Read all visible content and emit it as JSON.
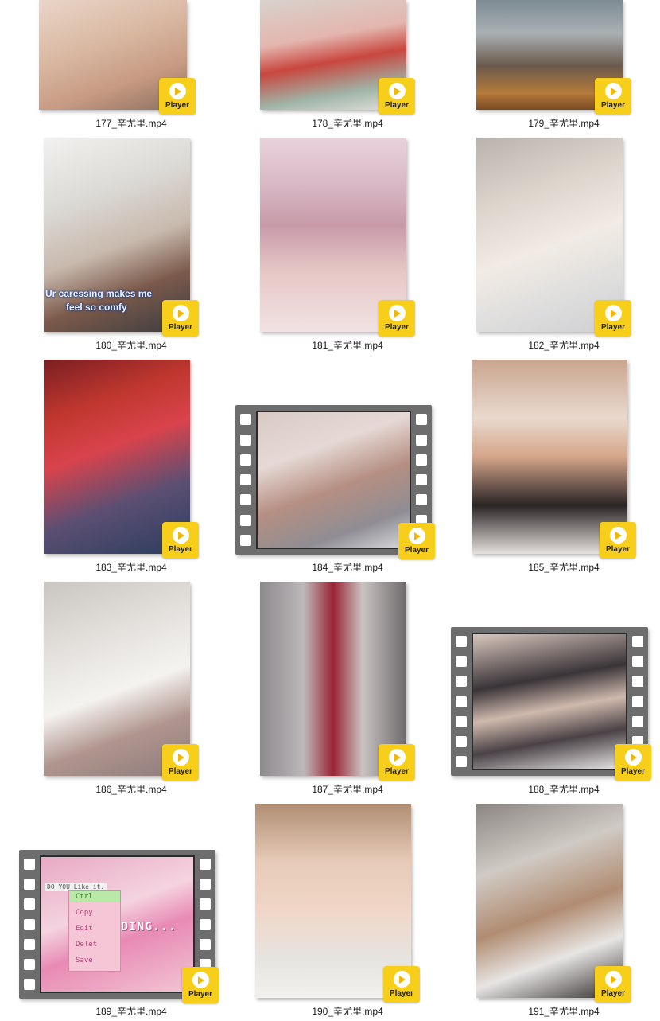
{
  "player_label": "Player",
  "items": [
    {
      "id": "177",
      "file": "177_辛尤里.mp4",
      "kind": "thumb",
      "bg": "linear-gradient(160deg,#e9d5c8 0%,#d9b8a2 40%,#c79a82 70%,#8a6e5e 100%)"
    },
    {
      "id": "178",
      "file": "178_辛尤里.mp4",
      "kind": "thumb",
      "bg": "linear-gradient(170deg,#d8d2cc 0%,#e3b6ae 35%,#c9473f 55%,#9fb5a8 80%,#e7e1da 100%)"
    },
    {
      "id": "179",
      "file": "179_辛尤里.mp4",
      "kind": "thumb",
      "bg": "linear-gradient(180deg,#7d8b93 0%,#a8b0b3 30%,#6b5a4c 60%,#b57a3a 85%,#7a4a22 100%)"
    },
    {
      "id": "180",
      "file": "180_辛尤里.mp4",
      "kind": "thumb",
      "bg": "linear-gradient(160deg,#f1f1ef 0%,#dcdad6 30%,#c8b9ad 55%,#7b5a4b 75%,#3b3b3f 100%)",
      "caption_lines": [
        "Ur caressing makes me",
        "feel so comfy"
      ]
    },
    {
      "id": "181",
      "file": "181_辛尤里.mp4",
      "kind": "thumb",
      "bg": "linear-gradient(180deg,#e9d2dc 0%,#d7b7c4 25%,#c89aa8 45%,#e7c9c6 70%,#f1e1e3 100%)"
    },
    {
      "id": "182",
      "file": "182_辛尤里.mp4",
      "kind": "thumb",
      "bg": "linear-gradient(160deg,#b9b2ac 0%,#ddd4cc 30%,#f1ebe4 55%,#dcdcdc 80%,#cfcfd2 100%)"
    },
    {
      "id": "183",
      "file": "183_辛尤里.mp4",
      "kind": "thumb",
      "bg": "linear-gradient(160deg,#7a1e22 0%,#c0372f 25%,#d9434c 45%,#5b4f73 70%,#2b3d5e 100%)"
    },
    {
      "id": "184",
      "file": "184_辛尤里.mp4",
      "kind": "film",
      "bg": "linear-gradient(160deg,#d8c9c4 0%,#e6d9d5 30%,#b58f82 55%,#8f8d93 80%,#d9dade 100%)"
    },
    {
      "id": "185",
      "file": "185_辛尤里.mp4",
      "kind": "thumb",
      "bg": "linear-gradient(180deg,#c9a58f 0%,#e9d9cd 30%,#d4a58a 50%,#2a2426 75%,#e6e1dd 100%)"
    },
    {
      "id": "186",
      "file": "186_辛尤里.mp4",
      "kind": "thumb",
      "bg": "linear-gradient(160deg,#c9c5c1 0%,#e3e0dc 30%,#f5f3f0 55%,#b0958e 75%,#8d7b7a 100%)"
    },
    {
      "id": "187",
      "file": "187_辛尤里.mp4",
      "kind": "thumb",
      "bg": "linear-gradient(90deg,#8d8a8e 0%,#bdb7b8 30%,#9b2435 50%,#c8c3c1 70%,#6e6a6c 100%)"
    },
    {
      "id": "188",
      "file": "188_辛尤里.mp4",
      "kind": "film",
      "bg": "linear-gradient(170deg,#d9c7bd 0%,#3a3438 35%,#cfb9ad 55%,#4a4246 75%,#e9e6e6 100%)"
    },
    {
      "id": "189",
      "file": "189_辛尤里.mp4",
      "kind": "film",
      "bg": "linear-gradient(160deg,#e8a9c4 0%,#f4d3df 40%,#e88ab4 60%,#f1c5d3 100%)",
      "menu": [
        "Ctrl",
        "Copy",
        "Edit",
        "Delet",
        "Save"
      ],
      "screen_text": "DO YOU Like it.",
      "loading": "ADING..."
    },
    {
      "id": "190",
      "file": "190_辛尤里.mp4",
      "kind": "thumb",
      "bg": "linear-gradient(180deg,#b08e74 0%,#e7cbb8 30%,#f0d6c7 55%,#e6e4e0 80%,#f3f1ee 100%)"
    },
    {
      "id": "191",
      "file": "191_辛尤里.mp4",
      "kind": "thumb",
      "bg": "linear-gradient(160deg,#8b8683 0%,#d0cac4 30%,#b08c72 55%,#e7e5e3 75%,#2e2a2a 100%)"
    }
  ]
}
